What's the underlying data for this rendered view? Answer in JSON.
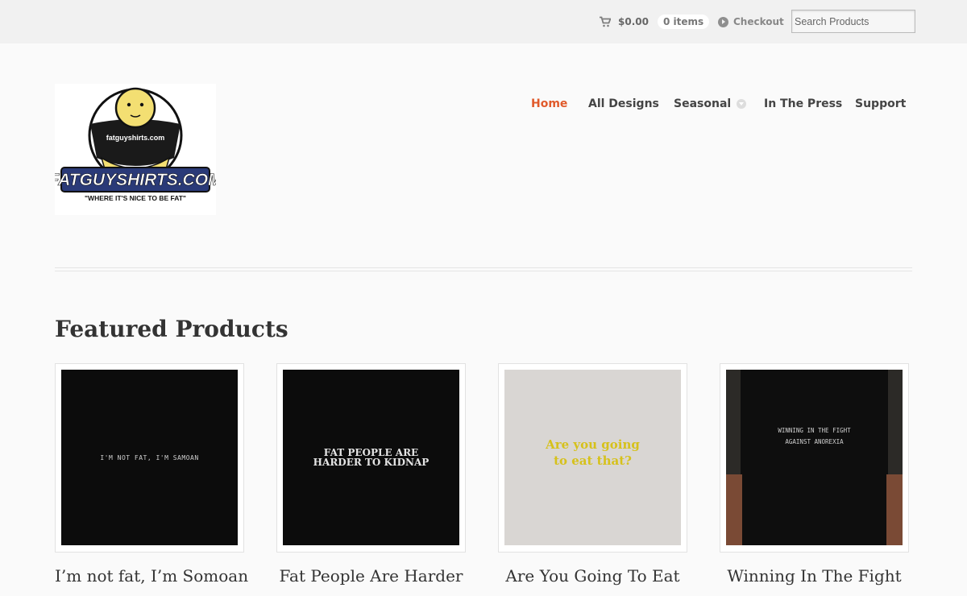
{
  "topbar": {
    "cart_icon": "cart-icon",
    "cart_total": "$0.00",
    "cart_count": "0 items",
    "checkout_icon": "play-circle-icon",
    "checkout_label": "Checkout",
    "search_placeholder": "Search Products"
  },
  "logo": {
    "site_name": "FATGUYSHIRTS.COM",
    "shirt_text": "fatguyshirts.com",
    "tagline": "\"WHERE IT'S NICE TO BE FAT\""
  },
  "nav": {
    "items": [
      {
        "label": "Home",
        "active": true
      },
      {
        "label": "All Designs"
      },
      {
        "label": "Seasonal",
        "has_dropdown": true
      },
      {
        "label": "In The Press"
      },
      {
        "label": "Support"
      }
    ],
    "accent_color": "#e05a2b"
  },
  "featured": {
    "title": "Featured Products",
    "products": [
      {
        "title": "I’m not fat, I’m Somoan",
        "shirt_text": "I'm not fat, I'm Samoan"
      },
      {
        "title": "Fat People Are Harder",
        "shirt_text_line1": "Fat people are",
        "shirt_text_line2": "harder to kidnap"
      },
      {
        "title": "Are You Going To Eat",
        "shirt_text_line1": "Are you going",
        "shirt_text_line2": "to eat that?"
      },
      {
        "title": "Winning In The Fight",
        "shirt_text_line1": "Winning in the fight",
        "shirt_text_line2": "against anorexia"
      }
    ]
  }
}
